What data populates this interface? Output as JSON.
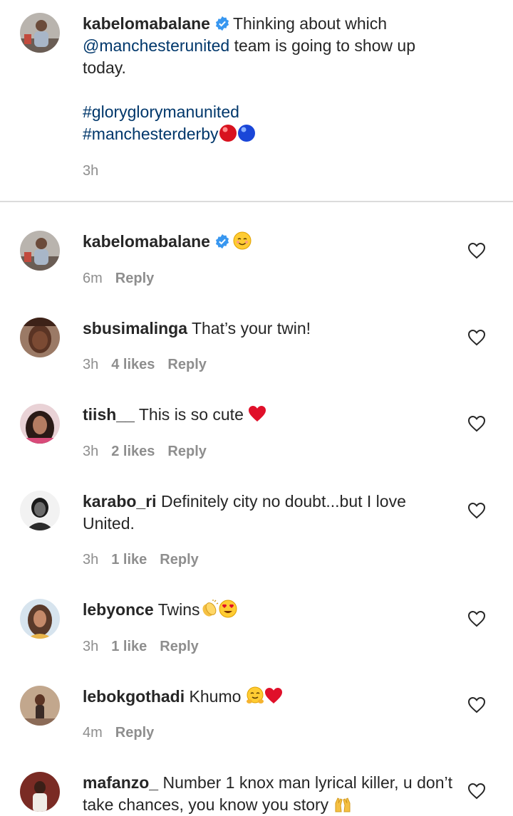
{
  "caption": {
    "username": "kabelomabalane",
    "text_prefix": "Thinking about which",
    "mention": "@manchesterunited",
    "text_suffix": "team is going to show up today.",
    "hashtag1": "#glorygloryman​united",
    "hashtag2": "#manchesterderby",
    "time": "3h"
  },
  "comments": [
    {
      "username": "kabelomabalane",
      "verified": true,
      "text": "",
      "emoji": "smiling-face",
      "time": "6m",
      "likes": "",
      "reply": "Reply"
    },
    {
      "username": "sbusimalinga",
      "text": "That’s your twin!",
      "time": "3h",
      "likes": "4 likes",
      "reply": "Reply"
    },
    {
      "username": "tiish__",
      "text": "This is so cute",
      "emoji": "red-heart",
      "time": "3h",
      "likes": "2 likes",
      "reply": "Reply"
    },
    {
      "username": "karabo_ri",
      "text": "Definitely city no doubt...but I love United.",
      "time": "3h",
      "likes": "1 like",
      "reply": "Reply"
    },
    {
      "username": "lebyonce",
      "text": "Twins",
      "emoji": "clapping-hands heart-eyes",
      "time": "3h",
      "likes": "1 like",
      "reply": "Reply"
    },
    {
      "username": "lebokgothadi",
      "text": "Khumo",
      "emoji": "hugging-face red-heart",
      "time": "4m",
      "likes": "",
      "reply": "Reply"
    },
    {
      "username": "mafanzo_",
      "text": "Number 1 knox man lyrical killer, u don’t take chances, you know you story",
      "emoji": "raising-hands",
      "time": "",
      "likes": "",
      "reply": ""
    }
  ],
  "colors": {
    "link": "#00376b",
    "muted": "#8e8e8e",
    "verified": "#3897f0",
    "heart_emoji": "#e0102a"
  }
}
